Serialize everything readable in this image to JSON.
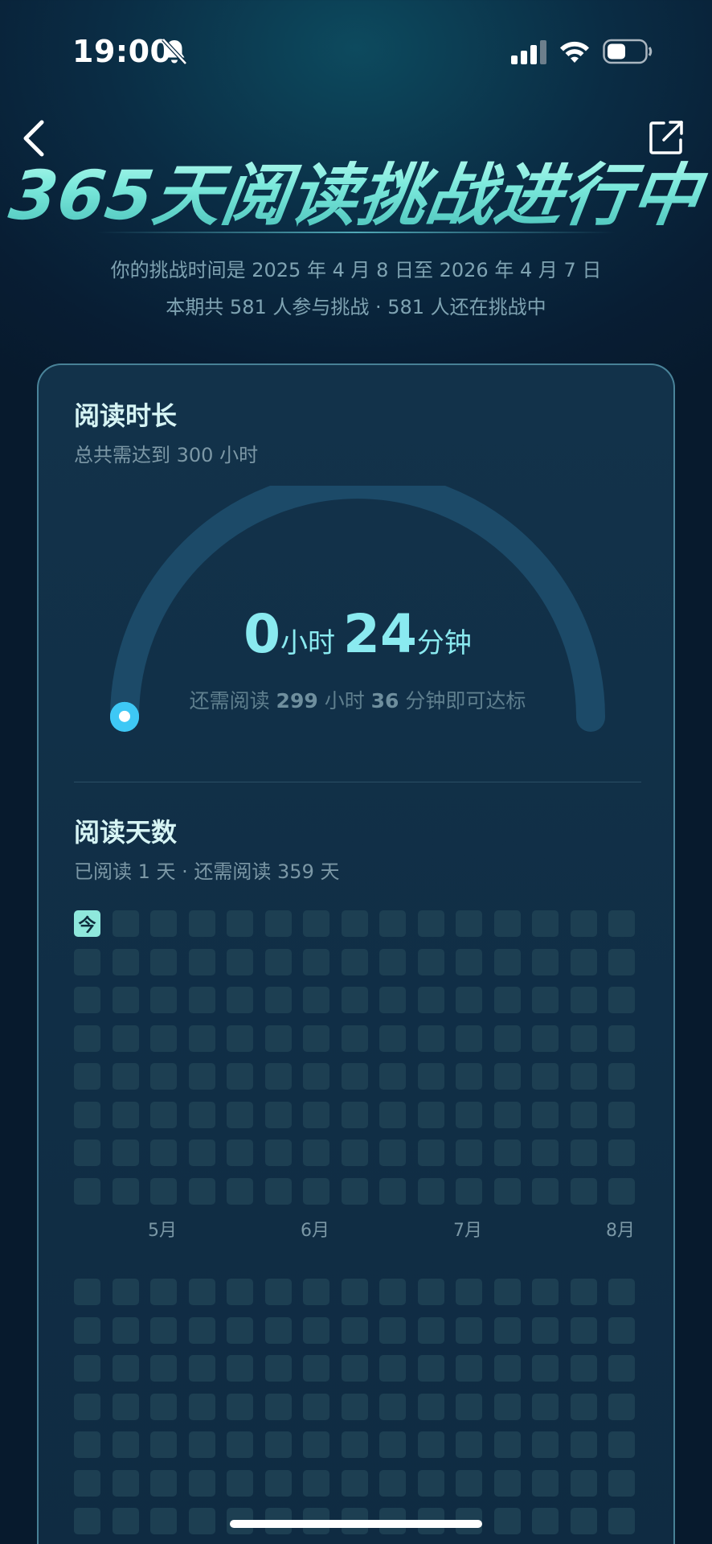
{
  "status_bar": {
    "time": "19:00"
  },
  "header": {
    "title": "365天阅读挑战进行中",
    "subtitle_1": "你的挑战时间是 2025 年 4 月 8 日至 2026 年 4 月 7 日",
    "subtitle_2": "本期共 581 人参与挑战 · 581 人还在挑战中"
  },
  "reading_time": {
    "title": "阅读时长",
    "subtitle": "总共需达到 300 小时",
    "hours": "0",
    "hours_unit": "小时",
    "minutes": "24",
    "minutes_unit": "分钟",
    "note_prefix": "还需阅读",
    "remaining_hours": "299",
    "note_hours_unit": "小时",
    "remaining_minutes": "36",
    "note_suffix": "分钟即可达标",
    "progress_fraction": 0.0013
  },
  "reading_days": {
    "title": "阅读天数",
    "subtitle": "已阅读 1 天 · 还需阅读 359 天",
    "today_label": "今",
    "months": [
      "5月",
      "6月",
      "7月",
      "8月"
    ]
  },
  "colors": {
    "accent": "#8fe8dc",
    "progress_dot": "#3ec8f5",
    "gauge_track": "#1c4a68"
  },
  "icons": {
    "back": "chevron-left-icon",
    "share": "share-external-icon",
    "bell_muted": "bell-slash-icon",
    "signal": "cellular-signal-icon",
    "wifi": "wifi-icon",
    "battery": "battery-icon"
  }
}
